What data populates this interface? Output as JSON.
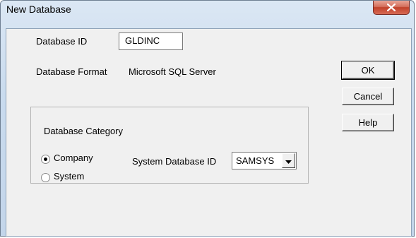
{
  "window": {
    "title": "New Database"
  },
  "form": {
    "database_id_label": "Database ID",
    "database_id_value": "GLDINC",
    "database_format_label": "Database Format",
    "database_format_value": "Microsoft SQL Server"
  },
  "buttons": {
    "ok": "OK",
    "cancel": "Cancel",
    "help": "Help"
  },
  "category": {
    "group_label": "Database Category",
    "options": [
      {
        "label": "Company",
        "selected": true
      },
      {
        "label": "System",
        "selected": false
      }
    ],
    "system_db_label": "System Database ID",
    "system_db_value": "SAMSYS"
  },
  "icons": {
    "close": "close-icon",
    "dropdown": "dropdown-arrow-icon"
  },
  "colors": {
    "close_button": "#c1412a",
    "dialog_face": "#f0f0f0",
    "frame": "#c9dbee"
  }
}
